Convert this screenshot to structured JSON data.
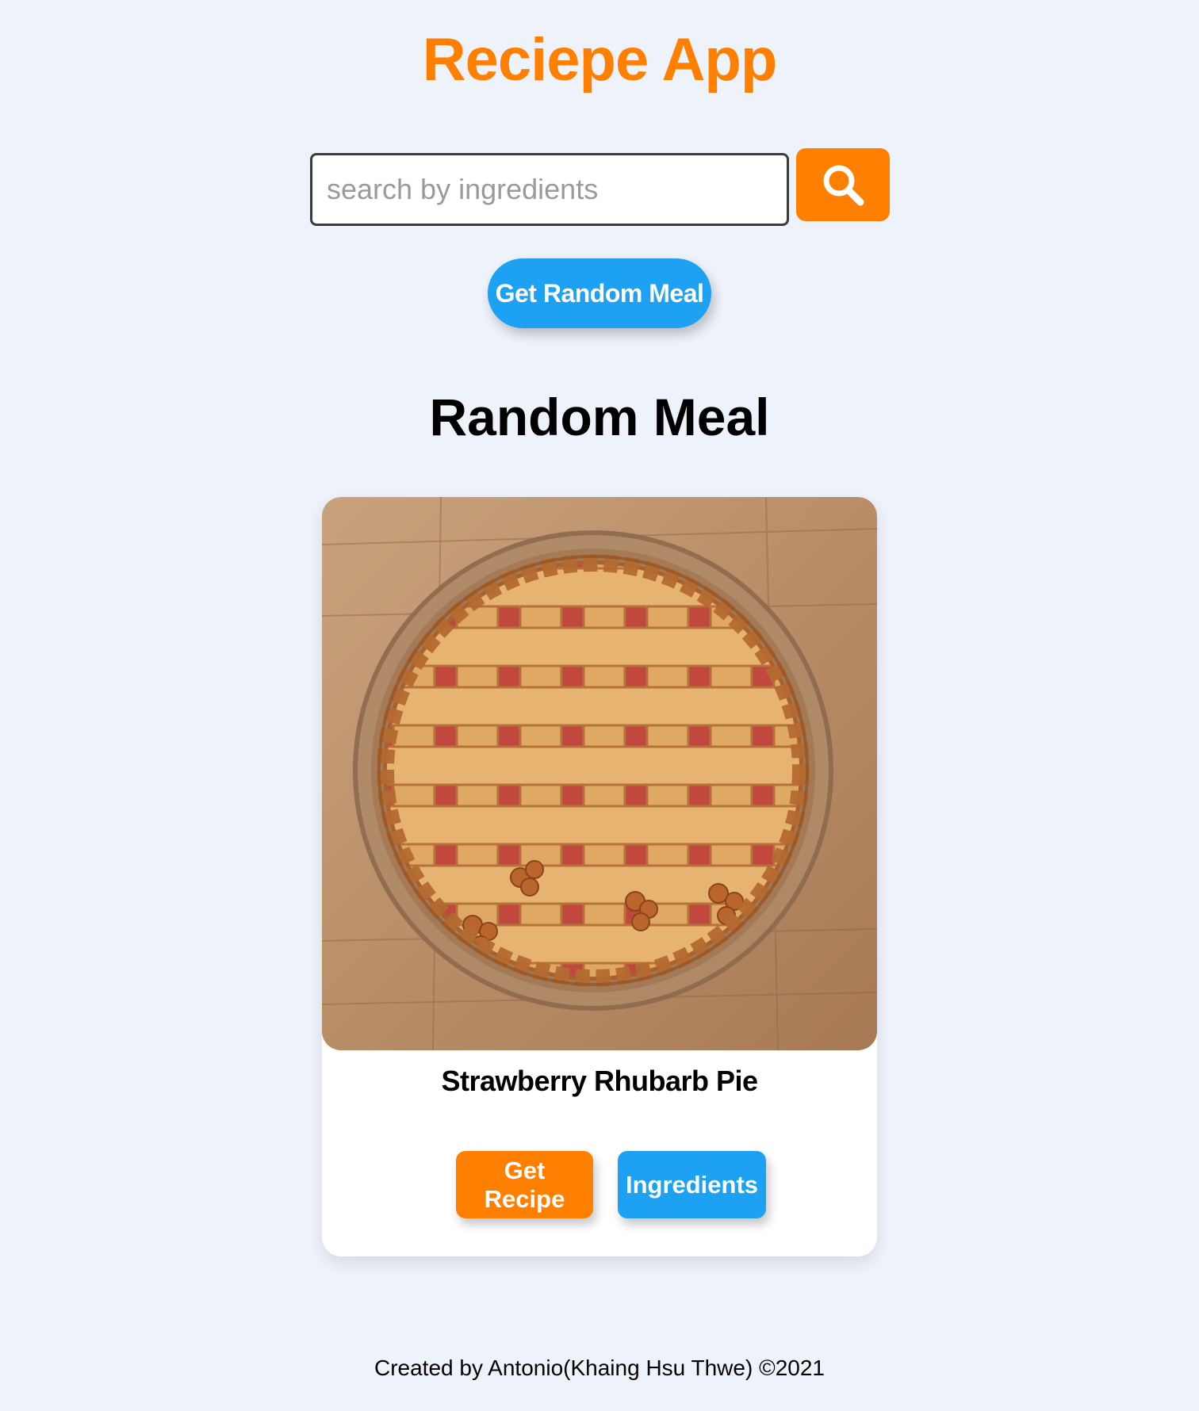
{
  "header": {
    "title": "Reciepe App"
  },
  "search": {
    "placeholder": "search by ingredients",
    "value": "",
    "button_icon": "search-icon"
  },
  "random_button": {
    "label": "Get Random Meal"
  },
  "section": {
    "title": "Random Meal"
  },
  "meal_card": {
    "name": "Strawberry Rhubarb Pie",
    "image_icon": "lattice-pie-image",
    "get_recipe_label": "Get Recipe",
    "ingredients_label": "Ingredients"
  },
  "footer": {
    "text": "Created by Antonio(Khaing Hsu Thwe) ©2021"
  },
  "colors": {
    "accent_orange": "#ff8000",
    "accent_blue": "#1da1f2",
    "background": "#eef2fa",
    "card": "#ffffff"
  }
}
